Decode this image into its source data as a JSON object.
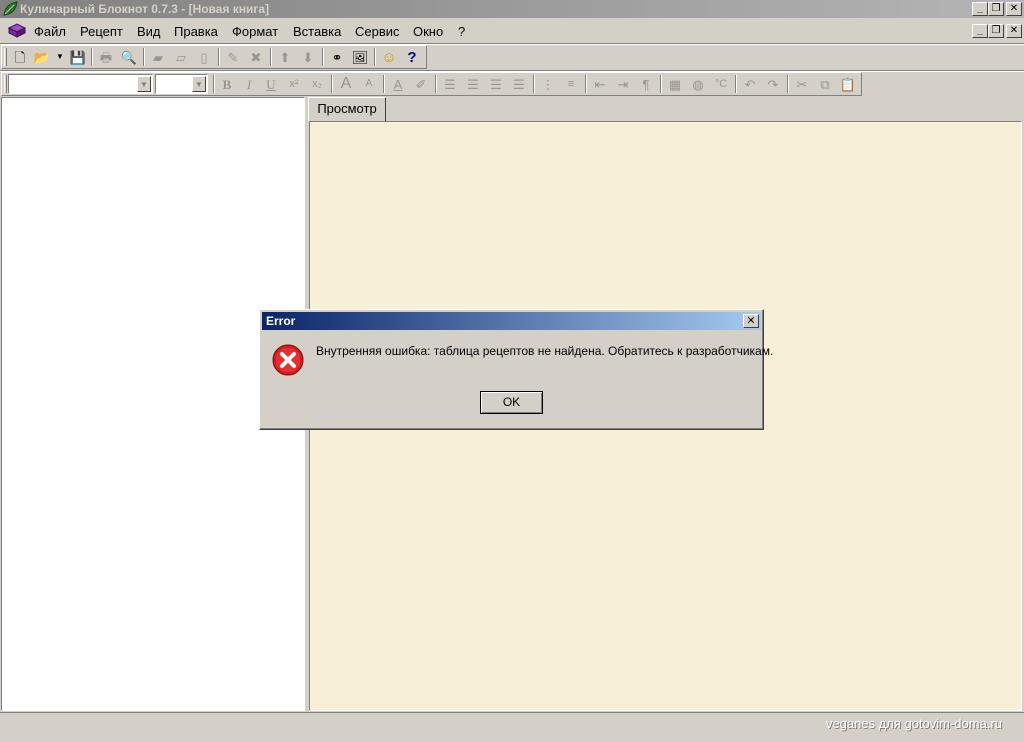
{
  "window": {
    "title": "Кулинарный Блокнот 0.7.3 - [Новая книга]",
    "caption_buttons": [
      "minimize-icon",
      "restore-icon",
      "close-icon"
    ]
  },
  "menu": {
    "items": [
      "Файл",
      "Рецепт",
      "Вид",
      "Правка",
      "Формат",
      "Вставка",
      "Сервис",
      "Окно",
      "?"
    ]
  },
  "toolbar1": {
    "icons": [
      "new-icon",
      "open-icon",
      "save-icon",
      "print-icon",
      "print-preview-icon",
      "book-icon",
      "open-book-icon",
      "page-icon",
      "edit-icon",
      "delete-icon",
      "arrow-up-icon",
      "arrow-down-icon",
      "binoculars-icon",
      "picture-icon",
      "smiley-icon",
      "help-icon"
    ]
  },
  "toolbar2": {
    "font_value": "",
    "size_value": "",
    "icons": [
      "bold-icon",
      "italic-icon",
      "underline-icon",
      "superscript-icon",
      "subscript-icon",
      "grow-font-icon",
      "shrink-font-icon",
      "font-color-icon",
      "highlight-icon",
      "align-left-icon",
      "align-center-icon",
      "align-right-icon",
      "justify-icon",
      "bullets-icon",
      "numbering-icon",
      "outdent-icon",
      "indent-icon",
      "paragraph-icon",
      "insert-image-icon",
      "globe-icon",
      "celsius-icon",
      "undo-icon",
      "redo-icon",
      "cut-icon",
      "copy-icon",
      "paste-icon"
    ]
  },
  "tabs": {
    "preview_label": "Просмотр"
  },
  "colors": {
    "preview_background": "#f8f0d6",
    "dialog_title_start": "#0a246a",
    "dialog_title_end": "#a6caf0"
  },
  "dialog": {
    "title": "Error",
    "message": "Внутренняя ошибка: таблица рецептов не найдена. Обратитесь к разработчикам.",
    "ok_label": "OK",
    "icon": "error-icon"
  },
  "status": {
    "watermark": "veganes для gotovim-doma.ru"
  }
}
